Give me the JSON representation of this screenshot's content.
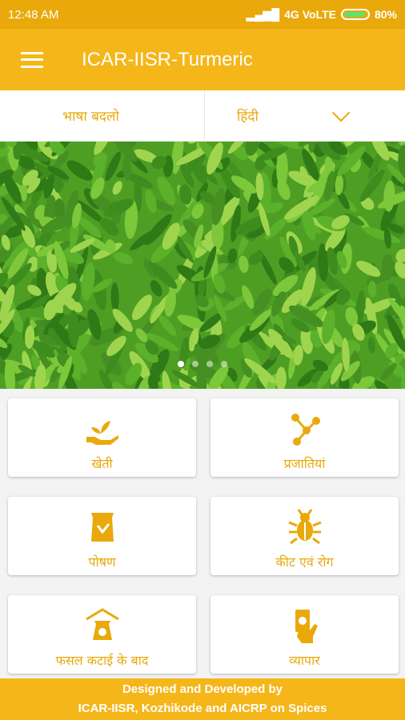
{
  "status": {
    "time": "12:48 AM",
    "network": "4G VoLTE",
    "battery": "80%"
  },
  "appbar": {
    "title": "ICAR-IISR-Turmeric"
  },
  "language": {
    "label": "भाषा बदलो",
    "selected": "हिंदी"
  },
  "banner": {
    "slide_count": 4,
    "active_slide": 1
  },
  "menu": [
    {
      "label": "खेती",
      "icon": "planting-hand-icon"
    },
    {
      "label": "प्रजातियां",
      "icon": "molecule-icon"
    },
    {
      "label": "पोषण",
      "icon": "fertilizer-bag-icon"
    },
    {
      "label": "कीट एवं रोग",
      "icon": "bug-icon"
    },
    {
      "label": "फसल कटाई के बाद",
      "icon": "storage-house-icon"
    },
    {
      "label": "व्यापार",
      "icon": "money-hand-icon"
    }
  ],
  "footer": {
    "line1": "Designed and Developed by",
    "line2": "ICAR-IISR, Kozhikode and AICRP on Spices"
  },
  "colors": {
    "primary": "#f5b61a",
    "accent": "#e9a90b"
  }
}
